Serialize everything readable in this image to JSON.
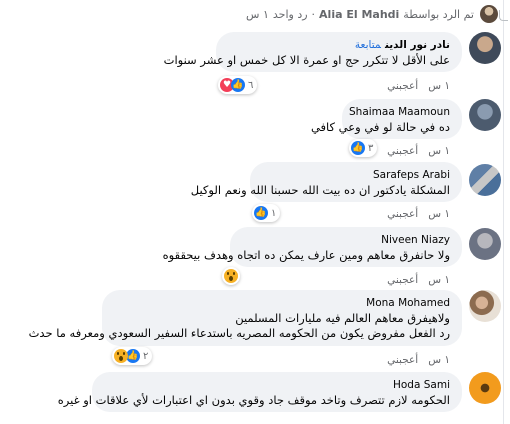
{
  "reply_header": {
    "prefix": "تم الرد بواسطة",
    "author": "Alia El Mahdi",
    "separator": "·",
    "replies": "رد واحد",
    "time": "١ س"
  },
  "comments": [
    {
      "name": "نادر نور الدين",
      "follow": "متابعة",
      "text": "على الأقل لا تتكرر حج او عمرة الا كل خمس او عشر سنوات",
      "time": "١ س",
      "like": "أعجبني",
      "reactions": [
        "like",
        "love"
      ],
      "count": "٦"
    },
    {
      "name": "Shaimaa Maamoun",
      "text": "ده في حالة لو في وعي كافي",
      "time": "١ س",
      "like": "أعجبني",
      "reactions": [
        "like"
      ],
      "count": "٣"
    },
    {
      "name": "Sarafeps Arabi",
      "text": "المشكلة يادكتور ان ده بيت الله حسبنا الله ونعم الوكيل",
      "time": "١ س",
      "like": "أعجبني",
      "reactions": [
        "like"
      ],
      "count": "١"
    },
    {
      "name": "Niveen Niazy",
      "text": "ولا حانفرق معاهم ومين عارف يمكن ده اتجاه وهدف بيحققوه",
      "time": "١ س",
      "like": "أعجبني",
      "reactions": [
        "wow"
      ],
      "count": ""
    },
    {
      "name": "Mona Mohamed",
      "text_lines": [
        "ولاهيفرق معاهم العالم فيه مليارات المسلمين",
        "رد الفعل مفروض يكون من الحكومه المصريه باستدعاء السفير السعودي ومعرفه ما حدث"
      ],
      "time": "١ س",
      "like": "أعجبني",
      "reactions": [
        "like",
        "wow"
      ],
      "count": "٢"
    },
    {
      "name": "Hoda Sami",
      "text": "الحكومه لازم تتصرف وتاخد موقف جاد وقوي بدون اي اعتبارات لأي علاقات او غيره",
      "time": "١ س",
      "like": "أعجبني",
      "reactions": [],
      "count": ""
    }
  ]
}
